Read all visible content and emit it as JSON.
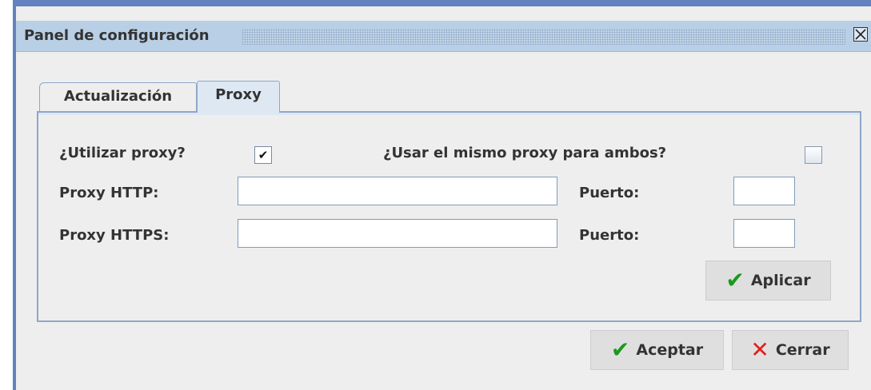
{
  "window": {
    "title": "Panel de configuración"
  },
  "tabs": [
    {
      "label": "Actualización",
      "active": false
    },
    {
      "label": "Proxy",
      "active": true
    }
  ],
  "proxy": {
    "use_proxy_label": "¿Utilizar proxy?",
    "use_proxy_checked": true,
    "same_proxy_label": "¿Usar el mismo proxy para ambos?",
    "same_proxy_checked": false,
    "http_label": "Proxy HTTP:",
    "http_value": "",
    "http_port_label": "Puerto:",
    "http_port_value": "",
    "https_label": "Proxy HTTPS:",
    "https_value": "",
    "https_port_label": "Puerto:",
    "https_port_value": "",
    "apply_label": "Aplicar"
  },
  "footer": {
    "accept_label": "Aceptar",
    "close_label": "Cerrar"
  },
  "colors": {
    "frame_border": "#6382bf",
    "titlebar": "#b8cfe5",
    "check_green": "#1a9a1a",
    "close_red": "#e02020"
  }
}
